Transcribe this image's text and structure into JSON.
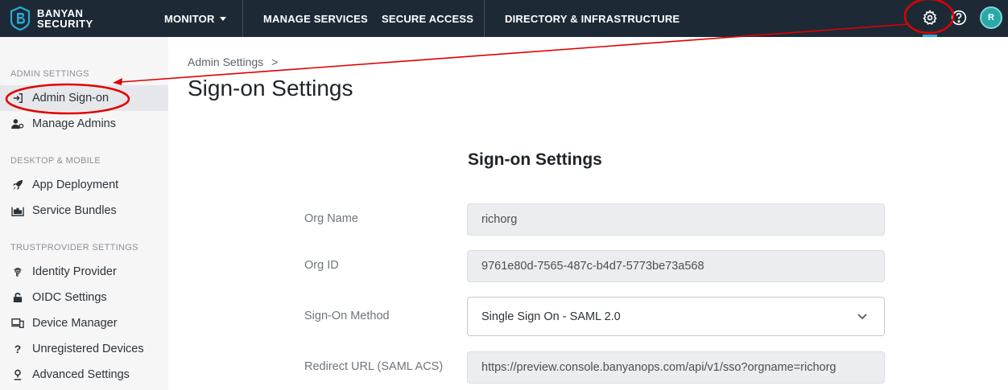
{
  "brand": {
    "line1": "BANYAN",
    "line2": "SECURITY"
  },
  "topnav": {
    "items": [
      {
        "label": "MONITOR"
      },
      {
        "label": "MANAGE SERVICES"
      },
      {
        "label": "SECURE ACCESS"
      },
      {
        "label": "DIRECTORY & INFRASTRUCTURE"
      }
    ],
    "icons": [
      "gear-icon",
      "help-icon"
    ],
    "avatar_initial": "R"
  },
  "sidebar": {
    "sections": [
      {
        "title": "ADMIN SETTINGS",
        "items": [
          {
            "label": "Admin Sign-on",
            "icon": "sign-in-icon",
            "active": true
          },
          {
            "label": "Manage Admins",
            "icon": "admin-user-icon"
          }
        ]
      },
      {
        "title": "DESKTOP & MOBILE",
        "items": [
          {
            "label": "App Deployment",
            "icon": "rocket-icon"
          },
          {
            "label": "Service Bundles",
            "icon": "bundle-icon"
          }
        ]
      },
      {
        "title": "TRUSTPROVIDER SETTINGS",
        "items": [
          {
            "label": "Identity Provider",
            "icon": "fingerprint-icon"
          },
          {
            "label": "OIDC Settings",
            "icon": "lock-icon"
          },
          {
            "label": "Device Manager",
            "icon": "devices-icon"
          },
          {
            "label": "Unregistered Devices",
            "icon": "question-icon"
          },
          {
            "label": "Advanced Settings",
            "icon": "advanced-icon"
          }
        ]
      }
    ]
  },
  "main": {
    "breadcrumb": "Admin Settings",
    "breadcrumb_sep": ">",
    "title": "Sign-on Settings",
    "form": {
      "title": "Sign-on Settings",
      "fields": [
        {
          "label": "Org Name",
          "value": "richorg"
        },
        {
          "label": "Org ID",
          "value": "9761e80d-7565-487c-b4d7-5773be73a568"
        },
        {
          "label": "Sign-On Method",
          "value": "Single Sign On - SAML 2.0"
        },
        {
          "label": "Redirect URL (SAML ACS)",
          "value": "https://preview.console.banyanops.com/api/v1/sso?orgname=richorg"
        }
      ]
    }
  },
  "colors": {
    "topbar": "#1d2a36",
    "accent": "#2ea6d6",
    "annotation": "#e00000"
  }
}
